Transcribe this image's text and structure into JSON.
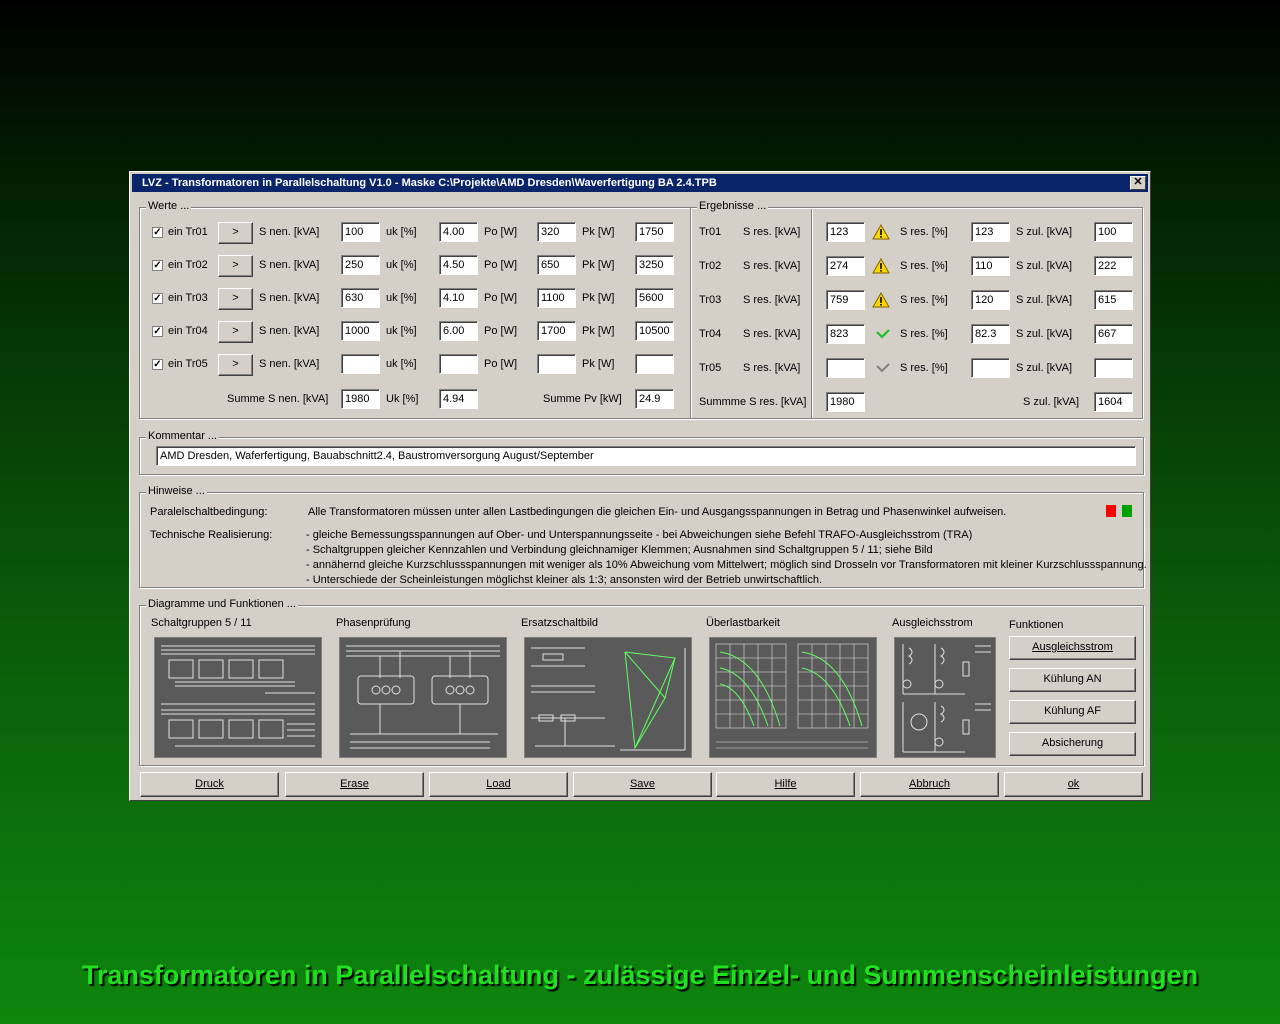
{
  "window": {
    "title": "LVZ - Transformatoren in Parallelschaltung V1.0 - Maske C:\\Projekte\\AMD Dresden\\Waverfertigung BA 2.4.TPB",
    "close_label": "✕"
  },
  "werte": {
    "legend": "Werte ...",
    "btn_label": ">",
    "labels": {
      "snen": "S nen. [kVA]",
      "uk": "uk [%]",
      "po": "Po [W]",
      "pk": "Pk [W]"
    },
    "rows": [
      {
        "name": "ein Tr01",
        "checked": "✓",
        "snen": "100",
        "uk": "4.00",
        "po": "320",
        "pk": "1750"
      },
      {
        "name": "ein Tr02",
        "checked": "✓",
        "snen": "250",
        "uk": "4.50",
        "po": "650",
        "pk": "3250"
      },
      {
        "name": "ein Tr03",
        "checked": "✓",
        "snen": "630",
        "uk": "4.10",
        "po": "1100",
        "pk": "5600"
      },
      {
        "name": "ein Tr04",
        "checked": "✓",
        "snen": "1000",
        "uk": "6.00",
        "po": "1700",
        "pk": "10500"
      },
      {
        "name": "ein Tr05",
        "checked": "✓",
        "snen": "",
        "uk": "",
        "po": "",
        "pk": ""
      }
    ],
    "sum": {
      "snen_label": "Summe S nen. [kVA]",
      "snen": "1980",
      "uk_label": "Uk [%]",
      "uk": "4.94",
      "pv_label": "Summe Pv [kW]",
      "pv": "24.9"
    }
  },
  "ergebnisse": {
    "legend": "Ergebnisse ...",
    "labels": {
      "sres": "S res. [kVA]",
      "sresp": "S res. [%]",
      "szul": "S zul. [kVA]"
    },
    "rows": [
      {
        "name": "Tr01",
        "sres": "123",
        "status": "warning",
        "sresp": "123",
        "szul": "100"
      },
      {
        "name": "Tr02",
        "sres": "274",
        "status": "warning",
        "sresp": "110",
        "szul": "222"
      },
      {
        "name": "Tr03",
        "sres": "759",
        "status": "warning",
        "sresp": "120",
        "szul": "615"
      },
      {
        "name": "Tr04",
        "sres": "823",
        "status": "ok",
        "sresp": "82.3",
        "szul": "667"
      },
      {
        "name": "Tr05",
        "sres": "",
        "status": "inactive",
        "sresp": "",
        "szul": ""
      }
    ],
    "sum": {
      "sres_label": "Summme S res. [kVA]",
      "sres": "1980",
      "szul_label": "S zul. [kVA]",
      "szul": "1604"
    }
  },
  "kommentar": {
    "legend": "Kommentar ...",
    "value": "AMD Dresden, Waferfertigung, Bauabschnitt2.4, Baustromversorgung August/September"
  },
  "hinweise": {
    "legend": "Hinweise ...",
    "bedingung_label": "Paralelschaltbedingung:",
    "bedingung_text": "Alle Transformatoren müssen unter allen Lastbedingungen die gleichen Ein- und Ausgangsspannungen in Betrag und Phasenwinkel aufweisen.",
    "realisierung_label": "Technische Realisierung:",
    "lines": [
      "- gleiche Bemessungsspannungen auf Ober- und Unterspannungsseite - bei Abweichungen siehe Befehl TRAFO-Ausgleichsstrom (TRA)",
      "- Schaltgruppen gleicher Kennzahlen und Verbindung gleichnamiger Klemmen; Ausnahmen sind Schaltgruppen 5 / 11; siehe Bild",
      "- annähernd gleiche Kurzschlussspannungen mit weniger als 10% Abweichung vom Mittelwert; möglich sind Drosseln vor Transformatoren mit kleiner Kurzschlussspannung.",
      "- Unterschiede der Scheinleistungen möglichst kleiner als 1:3; ansonsten wird der Betrieb unwirtschaftlich."
    ],
    "colors": {
      "red": "#ff0000",
      "green": "#00a000"
    }
  },
  "diagramme": {
    "legend": "Diagramme und Funktionen ...",
    "titles": [
      "Schaltgruppen 5 / 11",
      "Phasenprüfung",
      "Ersatzschaltbild",
      "Überlastbarkeit",
      "Ausgleichsstrom"
    ],
    "funktionen_label": "Funktionen",
    "buttons": [
      "Ausgleichsstrom",
      "Kühlung AN",
      "Kühlung AF",
      "Absicherung"
    ]
  },
  "bottom_buttons": [
    "Druck",
    "Erase",
    "Load",
    "Save",
    "Hilfe",
    "Abbruch",
    "ok"
  ],
  "caption": "Transformatoren in Parallelschaltung - zulässige Einzel- und Summenscheinleistungen"
}
